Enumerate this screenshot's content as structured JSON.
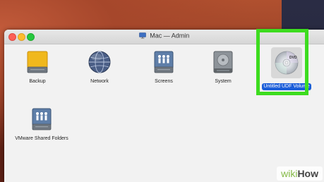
{
  "window": {
    "title": "Mac — Admin"
  },
  "items": [
    {
      "label": "Backup",
      "icon": "drive-icon"
    },
    {
      "label": "Network",
      "icon": "network-icon"
    },
    {
      "label": "Screens",
      "icon": "shared-screens-icon"
    },
    {
      "label": "System",
      "icon": "hard-drive-icon"
    },
    {
      "label": "Untitled UDF Volume",
      "icon": "dvd-icon",
      "selected": true
    },
    {
      "label": "VMware Shared Folders",
      "icon": "shared-drive-icon"
    }
  ],
  "watermark": {
    "wiki": "wiki",
    "how": "How"
  },
  "colors": {
    "selection": "#1b5dd9",
    "highlight": "#3ddc1f"
  }
}
